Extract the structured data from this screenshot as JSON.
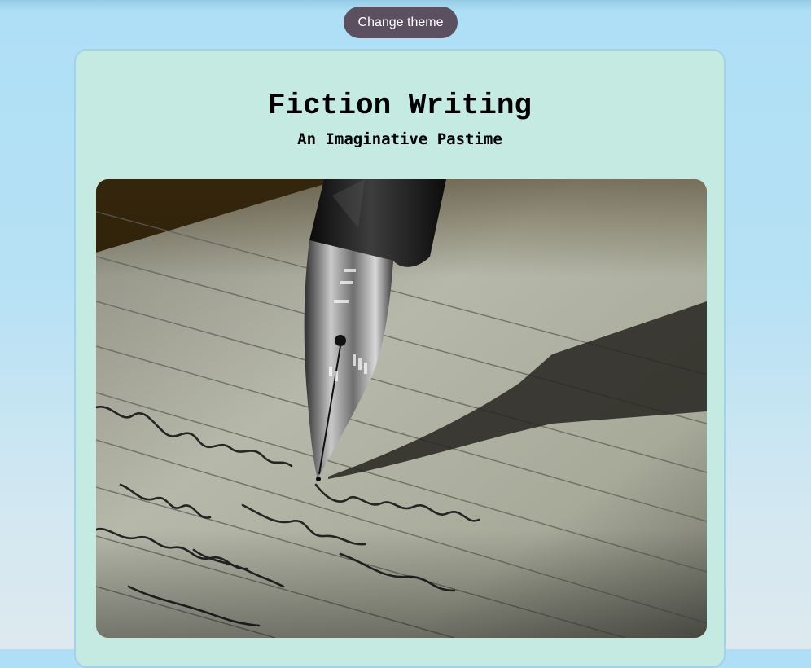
{
  "toolbar": {
    "change_theme_label": "Change theme"
  },
  "article": {
    "title": "Fiction Writing",
    "subtitle": "An Imaginative Pastime"
  },
  "image": {
    "subject": "fountain-pen-writing-on-lined-paper"
  },
  "colors": {
    "background": "#aedff6",
    "card": "#c4eae2",
    "card_border": "#9fd3ec",
    "button": "#5a5060",
    "button_text": "#ffffff"
  }
}
